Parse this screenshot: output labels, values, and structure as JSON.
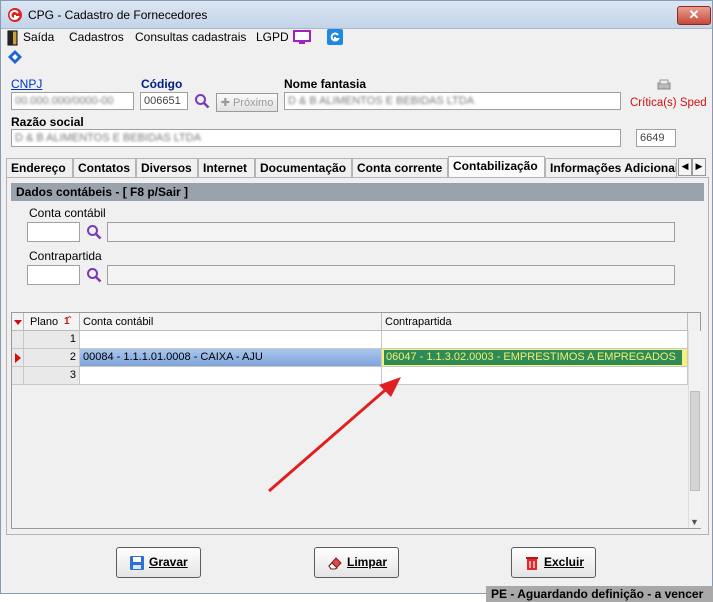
{
  "window": {
    "title": "CPG - Cadastro de Fornecedores",
    "close_label": "✕"
  },
  "menu": {
    "items": [
      "Saída",
      "Cadastros",
      "Consultas cadastrais",
      "LGPD"
    ]
  },
  "form": {
    "cnpj_label": "CNPJ",
    "cnpj_value": "00.000.000/0000-00",
    "codigo_label": "Código",
    "codigo_value": "006651",
    "proximo_label": "Próximo",
    "nome_fantasia_label": "Nome fantasia",
    "nome_fantasia_value": "D & B ALIMENTOS E BEBIDAS LTDA",
    "criticas_label": "Crítica(s) Sped",
    "razao_social_label": "Razão social",
    "razao_social_value": "D & B ALIMENTOS E BEBIDAS LTDA",
    "razao_extra_value": "6649"
  },
  "tabs": [
    "Endereço",
    "Contatos",
    "Diversos",
    "Internet",
    "Documentação",
    "Conta corrente",
    "Contabilização",
    "Informações Adicionai"
  ],
  "active_tab": "Contabilização",
  "section": {
    "title": "Dados contábeis - [ F8 p/Sair ]",
    "conta_contabil_label": "Conta contábil",
    "contrapartida_label": "Contrapartida"
  },
  "grid": {
    "columns": [
      "Plano",
      "Conta contábil",
      "Contrapartida"
    ],
    "rows": [
      {
        "plano": "1",
        "conta": "",
        "contrapartida": ""
      },
      {
        "plano": "2",
        "conta": "00084 - 1.1.1.01.0008 - CAIXA - AJU",
        "contrapartida": "06047 - 1.1.3.02.0003 - EMPRESTIMOS A EMPREGADOS"
      },
      {
        "plano": "3",
        "conta": "",
        "contrapartida": ""
      }
    ]
  },
  "buttons": {
    "gravar": "Gravar",
    "limpar": "Limpar",
    "excluir": "Excluir"
  },
  "status": {
    "text": "PE - Aguardando definição - a vencer"
  },
  "colors": {
    "highlight": "#f5f06a",
    "selected_row": "#8fb2e3",
    "selected_contra": "#2e8b57",
    "arrow": "#e02020"
  }
}
